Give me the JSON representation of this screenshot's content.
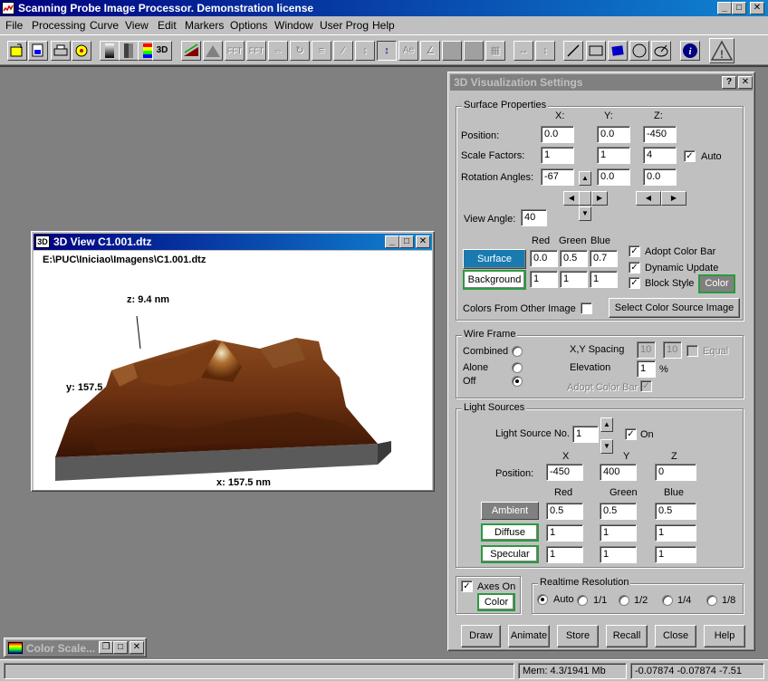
{
  "app": {
    "title": "Scanning Probe Image Processor. Demonstration license",
    "menu": [
      "File",
      "Processing",
      "Curve",
      "View",
      "Edit",
      "Markers",
      "Options",
      "Window",
      "User Prog",
      "Help"
    ]
  },
  "toolbar": {
    "icons": [
      "open-icon",
      "save-icon",
      "print-icon",
      "settings-icon",
      "gray-palette-icon",
      "gray-palette2-icon",
      "color-palette-icon",
      "color-bar-icon",
      "3d-icon",
      "plane-fit-icon",
      "filter-icon",
      "fft-icon",
      "ifft-icon",
      "nav-icon",
      "profile-icon",
      "line-icon",
      "slope-icon",
      "text-icon",
      "measure-icon",
      "ae-icon",
      "angle-icon",
      "shade-icon",
      "shade2-icon",
      "grid-icon",
      "h-arrow-icon",
      "v-arrow-icon",
      "line-draw-icon",
      "rectangle-icon",
      "fill-rect-icon",
      "circle-icon",
      "ellipse-icon",
      "info-icon",
      "warning-icon"
    ],
    "fft_label": "FFT",
    "ifft_label": "FFT",
    "text_label": "Ae"
  },
  "view3d": {
    "title": "3D View C1.001.dtz",
    "badge": "3D",
    "path": "E:\\PUC\\Iniciao\\Imagens\\C1.001.dtz",
    "z_label": "z: 9.4 nm",
    "y_label": "y: 157.5",
    "x_label": "x: 157.5 nm"
  },
  "settings": {
    "title": "3D Visualization Settings",
    "surface": {
      "group": "Surface Properties",
      "col_x": "X:",
      "col_y": "Y:",
      "col_z": "Z:",
      "position_label": "Position:",
      "position": [
        "0.0",
        "0.0",
        "-450"
      ],
      "scale_label": "Scale Factors:",
      "scale": [
        "1",
        "1",
        "4"
      ],
      "auto_label": "Auto",
      "rotation_label": "Rotation Angles:",
      "rotation": [
        "-67",
        "0.0",
        "0.0"
      ],
      "view_angle_label": "View Angle:",
      "view_angle": "40",
      "red": "Red",
      "green": "Green",
      "blue": "Blue",
      "surface_btn": "Surface",
      "surface_rgb": [
        "0.0",
        "0.5",
        "0.7"
      ],
      "background_btn": "Background",
      "background_rgb": [
        "1",
        "1",
        "1"
      ],
      "adopt_color_bar": "Adopt Color Bar",
      "dynamic_update": "Dynamic Update",
      "block_style": "Block Style",
      "color_btn": "Color",
      "colors_other": "Colors From Other Image",
      "select_source": "Select Color Source Image"
    },
    "wire": {
      "group": "Wire Frame",
      "combined": "Combined",
      "alone": "Alone",
      "off": "Off",
      "spacing_label": "X,Y Spacing",
      "spacing": [
        "10",
        "10"
      ],
      "equal": "Equal",
      "elevation_label": "Elevation",
      "elevation": "1",
      "percent": "%",
      "adopt": "Adopt Color Bar"
    },
    "light": {
      "group": "Light Sources",
      "source_no_label": "Light Source No.",
      "source_no": "1",
      "on_label": "On",
      "x": "X",
      "y": "Y",
      "z": "Z",
      "position_label": "Position:",
      "position": [
        "-450",
        "400",
        "0"
      ],
      "red": "Red",
      "green": "Green",
      "blue": "Blue",
      "ambient": "Ambient",
      "ambient_rgb": [
        "0.5",
        "0.5",
        "0.5"
      ],
      "diffuse": "Diffuse",
      "diffuse_rgb": [
        "1",
        "1",
        "1"
      ],
      "specular": "Specular",
      "specular_rgb": [
        "1",
        "1",
        "1"
      ]
    },
    "axes_on": "Axes On",
    "axes_color": "Color",
    "realtime": {
      "group": "Realtime Resolution",
      "options": [
        "Auto",
        "1/1",
        "1/2",
        "1/4",
        "1/8"
      ]
    },
    "buttons": [
      "Draw",
      "Animate",
      "Store",
      "Recall",
      "Close",
      "Help"
    ]
  },
  "colorscale": {
    "title": "Color Scale..."
  },
  "status": {
    "mem": "Mem: 4.3/1941 Mb",
    "coords": "-0.07874 -0.07874 -7.51"
  },
  "colors": {
    "title_active": "#000080",
    "title_inactive": "#808080",
    "workspace": "#808080"
  }
}
